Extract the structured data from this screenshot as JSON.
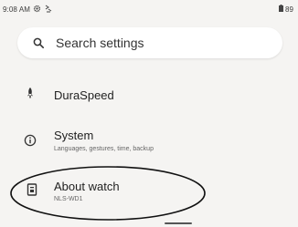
{
  "status_bar": {
    "time": "9:08 AM",
    "battery_text": "89",
    "icons": [
      "gear-icon",
      "notification-icon",
      "battery-icon"
    ]
  },
  "search": {
    "placeholder": "Search settings",
    "icon": "search-icon"
  },
  "settings_items": [
    {
      "title": "DuraSpeed",
      "subtitle": "",
      "icon": "rocket-icon"
    },
    {
      "title": "System",
      "subtitle": "Languages, gestures, time, backup",
      "icon": "info-icon"
    },
    {
      "title": "About watch",
      "subtitle": "NLS-WD1",
      "icon": "device-icon"
    }
  ],
  "colors": {
    "background": "#f5f4f2",
    "search_bg": "#ffffff",
    "text_primary": "#1f1f1f",
    "text_secondary": "#666666"
  }
}
